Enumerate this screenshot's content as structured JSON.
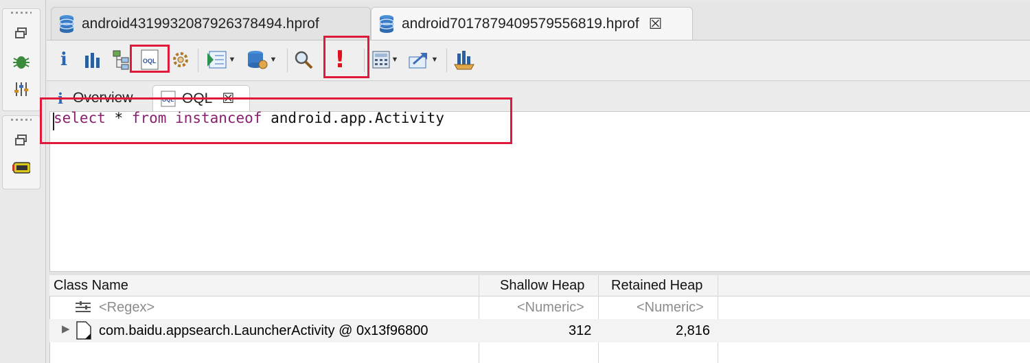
{
  "sidebar": {
    "icons": [
      "restore-icon",
      "debug-bug-icon",
      "sliders-icon",
      "restore-icon",
      "android-bot-icon"
    ]
  },
  "editor_tabs": [
    {
      "label": "android4319932087926378494.hprof",
      "active": false
    },
    {
      "label": "android7017879409579556819.hprof",
      "active": true,
      "close": "☒"
    }
  ],
  "toolbar": {
    "info": "i",
    "oql_label": "OQL",
    "leak_label": "!"
  },
  "sub_tabs": [
    {
      "label": "Overview",
      "icon": "i"
    },
    {
      "label": "OQL",
      "close": "☒"
    }
  ],
  "query": {
    "kw_select": "select",
    "star": " * ",
    "kw_from": "from",
    "space": " ",
    "kw_instanceof": "instanceof",
    "target": " android.app.Activity"
  },
  "table": {
    "columns": [
      "Class Name",
      "Shallow Heap",
      "Retained Heap"
    ],
    "filter_row": {
      "name": "<Regex>",
      "shallow": "<Numeric>",
      "retained": "<Numeric>"
    },
    "rows": [
      {
        "name": "com.baidu.appsearch.LauncherActivity @ 0x13f96800",
        "shallow": "312",
        "retained": "2,816"
      }
    ]
  },
  "colors": {
    "highlight": "#e0193a",
    "keyword": "#8a1f6e"
  }
}
